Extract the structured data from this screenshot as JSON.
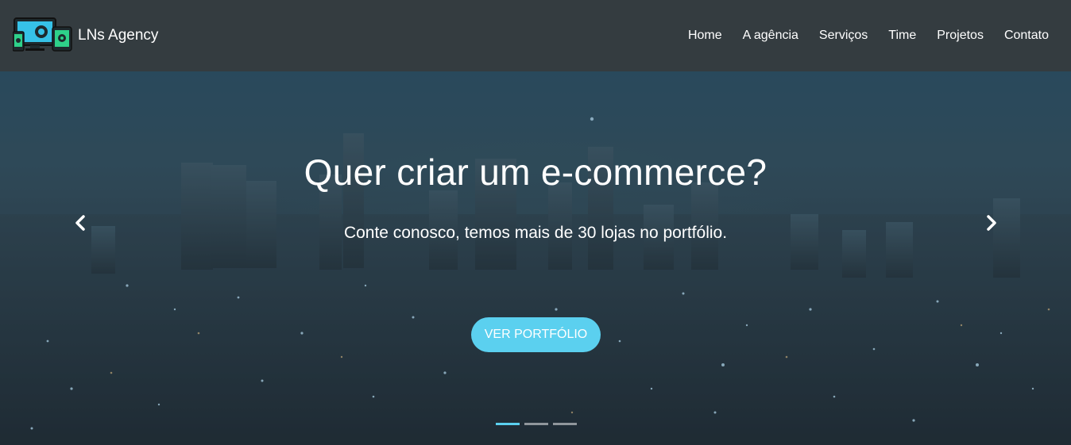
{
  "brand": {
    "name": "LNs Agency",
    "logo_icon": "devices-icon"
  },
  "nav": {
    "items": [
      {
        "label": "Home"
      },
      {
        "label": "A agência"
      },
      {
        "label": "Serviços"
      },
      {
        "label": "Time"
      },
      {
        "label": "Projetos"
      },
      {
        "label": "Contato"
      }
    ]
  },
  "hero": {
    "title": "Quer criar um e-commerce?",
    "subtitle": "Conte conosco, temos mais de 30 lojas no portfólio.",
    "cta_label": "VER PORTFÓLIO",
    "prev_icon": "chevron-left-icon",
    "next_icon": "chevron-right-icon",
    "slides_count": 3,
    "active_slide": 1
  },
  "colors": {
    "navbar": "#343c40",
    "accent": "#5bd0ef",
    "text": "#ffffff"
  }
}
